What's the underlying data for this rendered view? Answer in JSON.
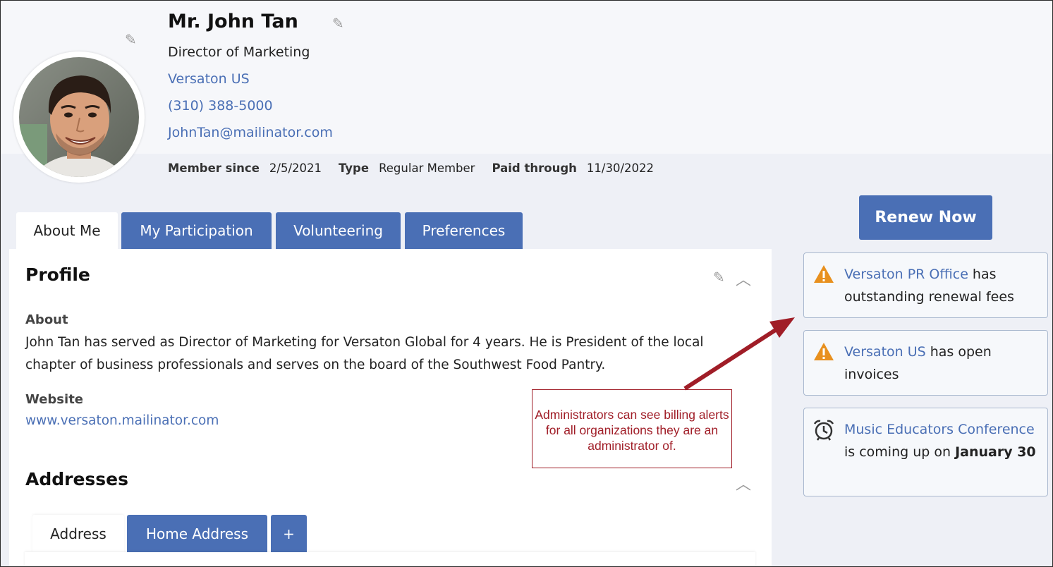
{
  "profile": {
    "name": "Mr. John Tan",
    "job_title": "Director of Marketing",
    "organization": "Versaton US",
    "phone": "(310) 388-5000",
    "email": "JohnTan@mailinator.com",
    "member_since_label": "Member since",
    "member_since": "2/5/2021",
    "type_label": "Type",
    "type": "Regular Member",
    "paid_through_label": "Paid through",
    "paid_through": "11/30/2022"
  },
  "tabs": [
    {
      "label": "About Me",
      "active": true
    },
    {
      "label": "My Participation",
      "active": false
    },
    {
      "label": "Volunteering",
      "active": false
    },
    {
      "label": "Preferences",
      "active": false
    }
  ],
  "profile_section": {
    "heading": "Profile",
    "about_label": "About",
    "about_text": "John Tan has served as Director of Marketing for Versaton Global for 4 years. He is President of the local chapter of business professionals and serves on the board of the Southwest Food Pantry.",
    "website_label": "Website",
    "website": "www.versaton.mailinator.com"
  },
  "addresses_section": {
    "heading": "Addresses",
    "tabs": [
      {
        "label": "Address",
        "active": true
      },
      {
        "label": "Home Address",
        "active": false
      },
      {
        "label": "+",
        "active": false
      }
    ]
  },
  "renew_button": "Renew Now",
  "alerts": [
    {
      "icon": "warning-icon",
      "org": "Versaton PR Office",
      "text": " has outstanding renewal fees",
      "bold": ""
    },
    {
      "icon": "warning-icon",
      "org": "Versaton US",
      "text": " has open invoices",
      "bold": ""
    },
    {
      "icon": "alarm-clock-icon",
      "org": "Music Educators Conference",
      "text": " is coming up on ",
      "bold": "January 30"
    }
  ],
  "callout": "Administrators can see billing alerts for all organizations they are an administrator of.",
  "colors": {
    "accent": "#4a6fb5",
    "warning": "#e8901e",
    "callout": "#a01d27"
  }
}
